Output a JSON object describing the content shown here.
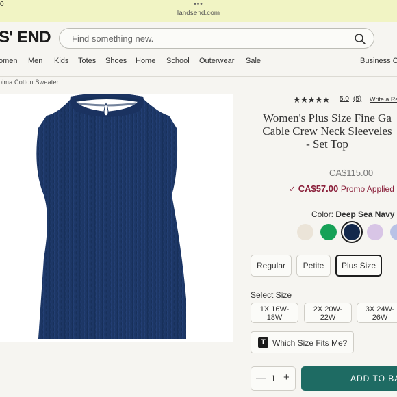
{
  "status": {
    "time": "0",
    "dots": "•••",
    "url": "landsend.com"
  },
  "header": {
    "logo": "S' END",
    "search_placeholder": "Find something new."
  },
  "nav": {
    "items": [
      "omen",
      "Men",
      "Kids",
      "Totes",
      "Shoes",
      "Home",
      "School",
      "Outerwear",
      "Sale",
      "Business Ou"
    ]
  },
  "breadcrumb": "pima Cotton Sweater",
  "product": {
    "stars": "★★★★★",
    "rating": "5.0",
    "review_count": "(5)",
    "write_review": "Write a Re",
    "title_lines": [
      "Women's Plus Size Fine Ga",
      "Cable Crew Neck Sleeveles",
      "- Set Top"
    ],
    "price": "CA$115.00",
    "promo_check": "✓",
    "promo_price": "CA$57.00",
    "promo_label": "Promo Applied",
    "color_label": "Color:",
    "color_name": "Deep Sea Navy",
    "swatches": [
      {
        "name": "ivory",
        "color": "#ebe4d8"
      },
      {
        "name": "green",
        "color": "#16a157"
      },
      {
        "name": "deep-sea-navy",
        "color": "#14294c"
      },
      {
        "name": "lavender",
        "color": "#d8c5e6"
      },
      {
        "name": "periwinkle",
        "color": "#b9c2e6"
      }
    ],
    "fits": [
      "Regular",
      "Petite",
      "Plus Size"
    ],
    "selected_fit": "Plus Size",
    "size_label": "Select Size",
    "sizes": [
      {
        "line1": "1X 16W-",
        "line2": "18W"
      },
      {
        "line1": "2X 20W-",
        "line2": "22W"
      },
      {
        "line1": "3X 24W-",
        "line2": "26W"
      }
    ],
    "fit_help_icon": "T",
    "fit_help": "Which Size Fits Me?",
    "quantity": "1",
    "qty_minus": "—",
    "qty_plus": "+",
    "add_to_bag": "ADD TO BA"
  },
  "colors": {
    "accent": "#1e6b63",
    "promo": "#8a1f3a",
    "sweater": "#1d3766"
  }
}
